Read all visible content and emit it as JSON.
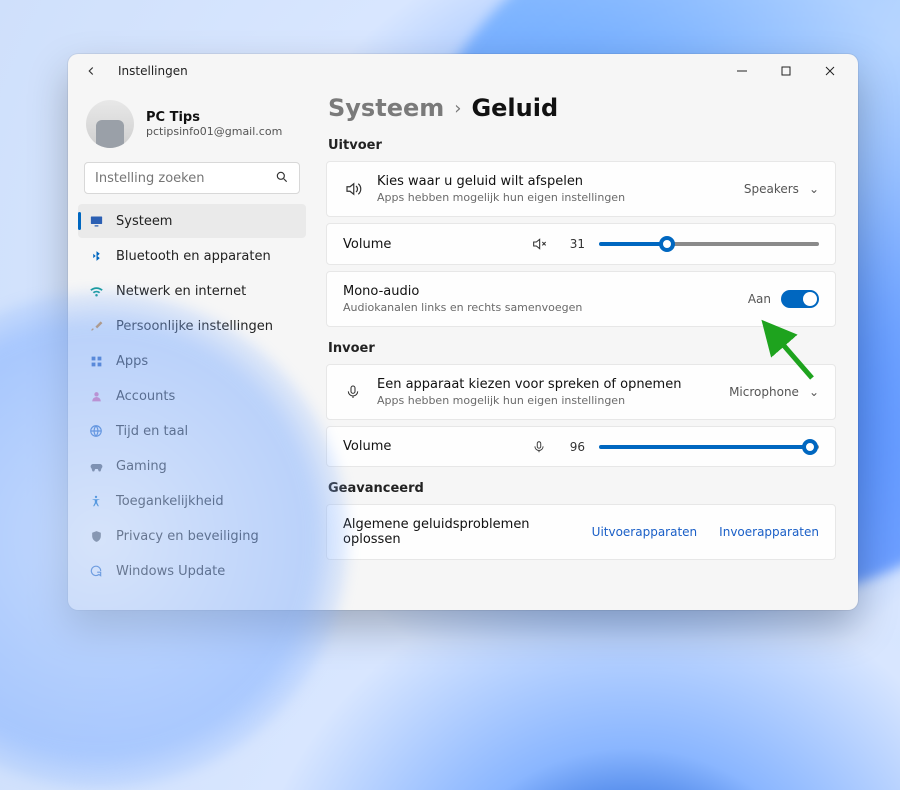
{
  "window": {
    "title": "Instellingen"
  },
  "profile": {
    "name": "PC Tips",
    "email": "pctipsinfo01@gmail.com"
  },
  "search": {
    "placeholder": "Instelling zoeken"
  },
  "nav": [
    {
      "key": "system",
      "label": "Systeem",
      "icon": "display",
      "icon_class": "i-navy",
      "active": true
    },
    {
      "key": "bluetooth",
      "label": "Bluetooth en apparaten",
      "icon": "bluetooth",
      "icon_class": "i-blue"
    },
    {
      "key": "network",
      "label": "Netwerk en internet",
      "icon": "wifi",
      "icon_class": "i-teal"
    },
    {
      "key": "personal",
      "label": "Persoonlijke instellingen",
      "icon": "brush",
      "icon_class": "i-orange"
    },
    {
      "key": "apps",
      "label": "Apps",
      "icon": "apps",
      "icon_class": "i-navy"
    },
    {
      "key": "accounts",
      "label": "Accounts",
      "icon": "person",
      "icon_class": "i-person"
    },
    {
      "key": "time",
      "label": "Tijd en taal",
      "icon": "globe",
      "icon_class": "i-globe"
    },
    {
      "key": "gaming",
      "label": "Gaming",
      "icon": "game",
      "icon_class": "i-gray"
    },
    {
      "key": "access",
      "label": "Toegankelijkheid",
      "icon": "access",
      "icon_class": "i-blue"
    },
    {
      "key": "privacy",
      "label": "Privacy en beveiliging",
      "icon": "shield",
      "icon_class": "i-gray"
    },
    {
      "key": "update",
      "label": "Windows Update",
      "icon": "sync",
      "icon_class": "i-sync"
    }
  ],
  "breadcrumb": {
    "parent": "Systeem",
    "current": "Geluid"
  },
  "sections": {
    "output": {
      "heading": "Uitvoer",
      "device": {
        "title": "Kies waar u geluid wilt afspelen",
        "subtitle": "Apps hebben mogelijk hun eigen instellingen",
        "value": "Speakers"
      },
      "volume": {
        "label": "Volume",
        "value": 31
      },
      "mono": {
        "title": "Mono-audio",
        "subtitle": "Audiokanalen links en rechts samenvoegen",
        "state_label": "Aan",
        "on": true
      }
    },
    "input": {
      "heading": "Invoer",
      "device": {
        "title": "Een apparaat kiezen voor spreken of opnemen",
        "subtitle": "Apps hebben mogelijk hun eigen instellingen",
        "value": "Microphone"
      },
      "volume": {
        "label": "Volume",
        "value": 96
      }
    },
    "advanced": {
      "heading": "Geavanceerd",
      "troubleshoot": {
        "title": "Algemene geluidsproblemen oplossen",
        "link_output": "Uitvoerapparaten",
        "link_input": "Invoerapparaten"
      }
    }
  }
}
